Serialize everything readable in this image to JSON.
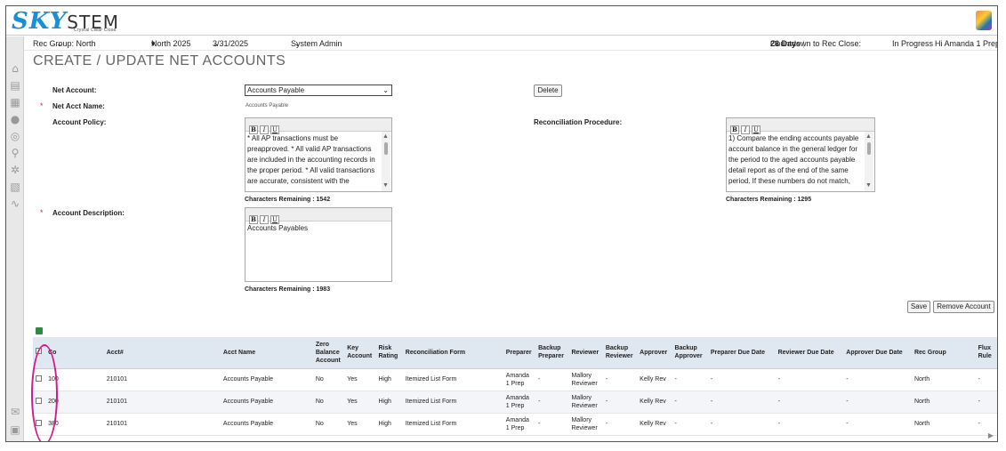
{
  "brand": {
    "logo_sky": "SKY",
    "logo_stem": "STEM",
    "tagline": "Crystal Clear Close"
  },
  "subbar": {
    "rec_group": "Rec Group:  North",
    "period": "North 2025",
    "date": "3/31/2025",
    "role": "System Admin",
    "countdown_label": "Countdown to Rec Close:",
    "countdown_value": "26 Days",
    "status": "In Progress",
    "greeting": "Hi Amanda 1 Prep"
  },
  "page": {
    "title": "CREATE / UPDATE NET ACCOUNTS"
  },
  "form": {
    "net_account_label": "Net Account:",
    "net_account_value": "Accounts Payable",
    "delete_label": "Delete",
    "net_acct_name_label": "Net Acct Name:",
    "net_acct_name_value": "Accounts Payable",
    "account_policy_label": "Account Policy:",
    "account_policy_text": "* All AP transactions must be preapproved. * All valid AP transactions are included in the accounting records in the proper period. * All valid transactions are accurate, consistent with the",
    "account_policy_remaining": "Characters Remaining : 1542",
    "rec_procedure_label": "Reconciliation Procedure:",
    "rec_procedure_text": "1) Compare the ending accounts payable account balance in the general ledger for the period to the aged accounts payable detail report as of the end of the same period.  If these numbers do not match,",
    "rec_procedure_remaining": "Characters Remaining : 1295",
    "account_description_label": "Account Description:",
    "account_description_text": "Accounts Payables",
    "account_description_remaining": "Characters Remaining : 1983",
    "editor_bold": "B",
    "editor_italic": "I",
    "editor_underline": "U",
    "save_label": "Save",
    "remove_label": "Remove Account"
  },
  "table": {
    "headers": {
      "co": "Co",
      "acct": "Acct#",
      "acct_name": "Acct Name",
      "zero_balance": "Zero Balance Account",
      "key_account": "Key Account",
      "risk_rating": "Risk Rating",
      "rec_form": "Reconciliation Form",
      "preparer": "Preparer",
      "backup_preparer": "Backup Preparer",
      "reviewer": "Reviewer",
      "backup_reviewer": "Backup Reviewer",
      "approver": "Approver",
      "backup_approver": "Backup Approver",
      "preparer_due": "Preparer Due Date",
      "reviewer_due": "Reviewer Due Date",
      "approver_due": "Approver Due Date",
      "rec_group": "Rec Group",
      "flux_rule": "Flux Rule"
    },
    "rows": [
      {
        "co": "100",
        "acct": "210101",
        "acct_name": "Accounts Payable",
        "zero_balance": "No",
        "key_account": "Yes",
        "risk_rating": "High",
        "rec_form": "Itemized List Form",
        "preparer": "Amanda 1 Prep",
        "backup_preparer": "-",
        "reviewer": "Mallory Reviewer",
        "backup_reviewer": "-",
        "approver": "Kelly Rev",
        "backup_approver": "-",
        "preparer_due": "-",
        "reviewer_due": "-",
        "approver_due": "-",
        "rec_group": "North",
        "flux_rule": "-"
      },
      {
        "co": "200",
        "acct": "210101",
        "acct_name": "Accounts Payable",
        "zero_balance": "No",
        "key_account": "Yes",
        "risk_rating": "High",
        "rec_form": "Itemized List Form",
        "preparer": "Amanda 1 Prep",
        "backup_preparer": "-",
        "reviewer": "Mallory Reviewer",
        "backup_reviewer": "-",
        "approver": "Kelly Rev",
        "backup_approver": "-",
        "preparer_due": "-",
        "reviewer_due": "-",
        "approver_due": "-",
        "rec_group": "North",
        "flux_rule": "-"
      },
      {
        "co": "380",
        "acct": "210101",
        "acct_name": "Accounts Payable",
        "zero_balance": "No",
        "key_account": "Yes",
        "risk_rating": "High",
        "rec_form": "Itemized List Form",
        "preparer": "Amanda 1 Prep",
        "backup_preparer": "-",
        "reviewer": "Mallory Reviewer",
        "backup_reviewer": "-",
        "approver": "Kelly Rev",
        "backup_approver": "-",
        "preparer_due": "-",
        "reviewer_due": "-",
        "approver_due": "-",
        "rec_group": "North",
        "flux_rule": "-"
      }
    ]
  },
  "colors": {
    "brand_blue": "#1a8fd6",
    "header_bg": "#dfe7f1",
    "highlight": "#d21b8a"
  }
}
